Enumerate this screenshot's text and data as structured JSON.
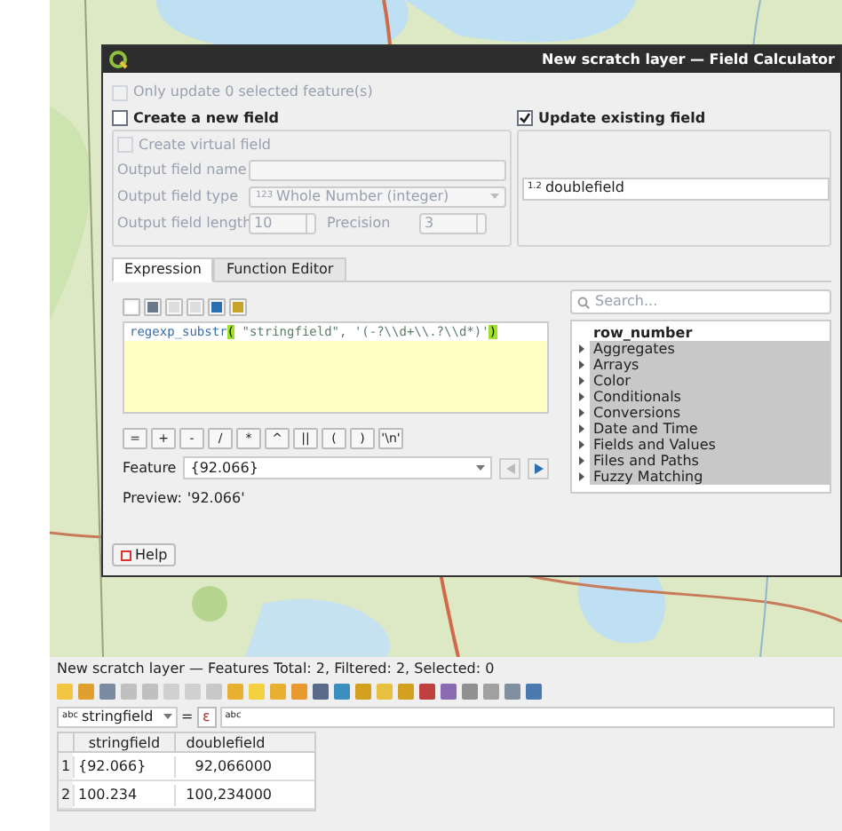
{
  "dialog": {
    "title": "New scratch layer — Field Calculator",
    "only_selected": {
      "label": "Only update 0 selected feature(s)",
      "checked": false,
      "disabled": true
    },
    "create_new": {
      "label": "Create a new field",
      "checked": false
    },
    "virtual": {
      "label": "Create virtual field",
      "checked": false,
      "disabled": true
    },
    "fields": [
      {
        "label": "Output field name",
        "kind": "text"
      },
      {
        "label": "Output field type",
        "kind": "combo",
        "badge": "123",
        "value": "Whole Number (integer)"
      },
      {
        "label": "Output field length",
        "kind": "spin",
        "value": "10",
        "extra_label": "Precision",
        "extra_value": "3"
      }
    ],
    "update_existing": {
      "label": "Update existing field",
      "checked": true,
      "badge": "1.2",
      "field": "doublefield"
    },
    "tabs": [
      {
        "label": "Expression",
        "selected": true
      },
      {
        "label": "Function Editor",
        "selected": false
      }
    ],
    "expression": [
      {
        "kind": "function",
        "text": "regexp_substr"
      },
      {
        "kind": "bracket",
        "text": "("
      },
      {
        "kind": "text",
        "text": " \"stringfield\", '(-?\\\\d+\\\\.?\\\\d*)'"
      },
      {
        "kind": "bracket",
        "text": ")"
      }
    ],
    "operators": [
      "=",
      "+",
      "-",
      "/",
      "*",
      "^",
      "||",
      "(",
      ")",
      "'\\n'"
    ],
    "feature": {
      "label": "Feature",
      "value": "{92.066}"
    },
    "preview": {
      "label": "Preview:",
      "value": "'92.066'"
    },
    "search": {
      "placeholder": "Search..."
    },
    "tree": [
      {
        "kind": "field",
        "label": "row_number"
      },
      {
        "kind": "group",
        "label": "Aggregates"
      },
      {
        "kind": "group",
        "label": "Arrays"
      },
      {
        "kind": "group",
        "label": "Color"
      },
      {
        "kind": "group",
        "label": "Conditionals"
      },
      {
        "kind": "group",
        "label": "Conversions"
      },
      {
        "kind": "group",
        "label": "Date and Time"
      },
      {
        "kind": "group",
        "label": "Fields and Values"
      },
      {
        "kind": "group",
        "label": "Files and Paths"
      },
      {
        "kind": "group",
        "label": "Fuzzy Matching"
      }
    ],
    "help": "Help"
  },
  "attribute_table": {
    "title": "New scratch layer — Features Total: 2, Filtered: 2, Selected: 0",
    "filter": {
      "badge": "abc",
      "field": "stringfield",
      "operator": "=",
      "expression_button": "ε",
      "value_badge": "abc"
    },
    "columns": [
      "stringfield",
      "doublefield"
    ],
    "rows": [
      {
        "number": "1",
        "cells": [
          "{92.066}",
          "92,066000"
        ]
      },
      {
        "number": "2",
        "cells": [
          "100.234",
          "100,234000"
        ]
      }
    ]
  }
}
